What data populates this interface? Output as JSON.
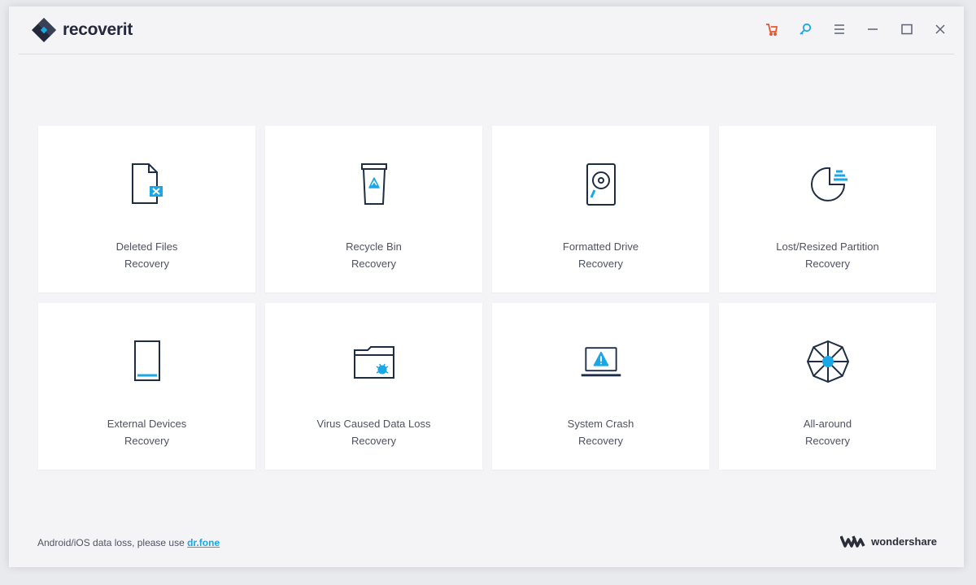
{
  "app": {
    "name": "recoverit"
  },
  "colors": {
    "accent": "#1aa7e6",
    "icon_stroke": "#1f2d44",
    "cart": "#e4572e"
  },
  "titlebar": {
    "controls": [
      {
        "icon": "cart-icon"
      },
      {
        "icon": "key-icon"
      },
      {
        "icon": "menu-icon"
      },
      {
        "icon": "minimize-icon"
      },
      {
        "icon": "maximize-icon"
      },
      {
        "icon": "close-icon"
      }
    ]
  },
  "modes": [
    {
      "line1": "Deleted Files",
      "line2": "Recovery",
      "icon": "deleted-file-icon"
    },
    {
      "line1": "Recycle Bin",
      "line2": "Recovery",
      "icon": "recycle-bin-icon"
    },
    {
      "line1": "Formatted Drive",
      "line2": "Recovery",
      "icon": "hard-drive-icon"
    },
    {
      "line1": "Lost/Resized Partition",
      "line2": "Recovery",
      "icon": "partition-icon"
    },
    {
      "line1": "External Devices",
      "line2": "Recovery",
      "icon": "external-device-icon"
    },
    {
      "line1": "Virus Caused Data Loss",
      "line2": "Recovery",
      "icon": "virus-folder-icon"
    },
    {
      "line1": "System Crash",
      "line2": "Recovery",
      "icon": "laptop-warning-icon"
    },
    {
      "line1": "All-around",
      "line2": "Recovery",
      "icon": "all-around-icon"
    }
  ],
  "footer": {
    "text": "Android/iOS data loss, please use",
    "link": "dr.fone",
    "brand": "wondershare"
  }
}
